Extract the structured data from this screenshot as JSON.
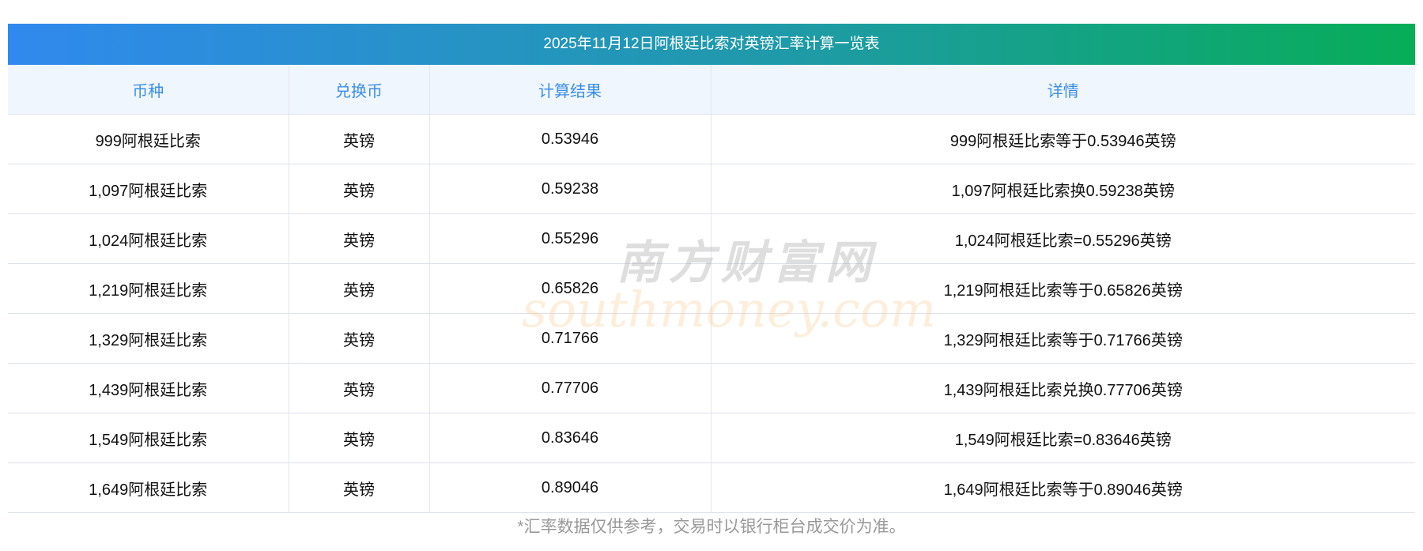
{
  "title": "2025年11月12日阿根廷比索对英镑汇率计算一览表",
  "columns": [
    "币种",
    "兑换币",
    "计算结果",
    "详情"
  ],
  "rows": [
    {
      "amount": "999阿根廷比索",
      "target": "英镑",
      "result": "0.53946",
      "detail": "999阿根廷比索等于0.53946英镑"
    },
    {
      "amount": "1,097阿根廷比索",
      "target": "英镑",
      "result": "0.59238",
      "detail": "1,097阿根廷比索换0.59238英镑"
    },
    {
      "amount": "1,024阿根廷比索",
      "target": "英镑",
      "result": "0.55296",
      "detail": "1,024阿根廷比索=0.55296英镑"
    },
    {
      "amount": "1,219阿根廷比索",
      "target": "英镑",
      "result": "0.65826",
      "detail": "1,219阿根廷比索等于0.65826英镑"
    },
    {
      "amount": "1,329阿根廷比索",
      "target": "英镑",
      "result": "0.71766",
      "detail": "1,329阿根廷比索等于0.71766英镑"
    },
    {
      "amount": "1,439阿根廷比索",
      "target": "英镑",
      "result": "0.77706",
      "detail": "1,439阿根廷比索兑换0.77706英镑"
    },
    {
      "amount": "1,549阿根廷比索",
      "target": "英镑",
      "result": "0.83646",
      "detail": "1,549阿根廷比索=0.83646英镑"
    },
    {
      "amount": "1,649阿根廷比索",
      "target": "英镑",
      "result": "0.89046",
      "detail": "1,649阿根廷比索等于0.89046英镑"
    }
  ],
  "note": "*汇率数据仅供参考，交易时以银行柜台成交价为准。",
  "watermark": {
    "cn": "南方财富网",
    "en": "southmoney.com"
  }
}
